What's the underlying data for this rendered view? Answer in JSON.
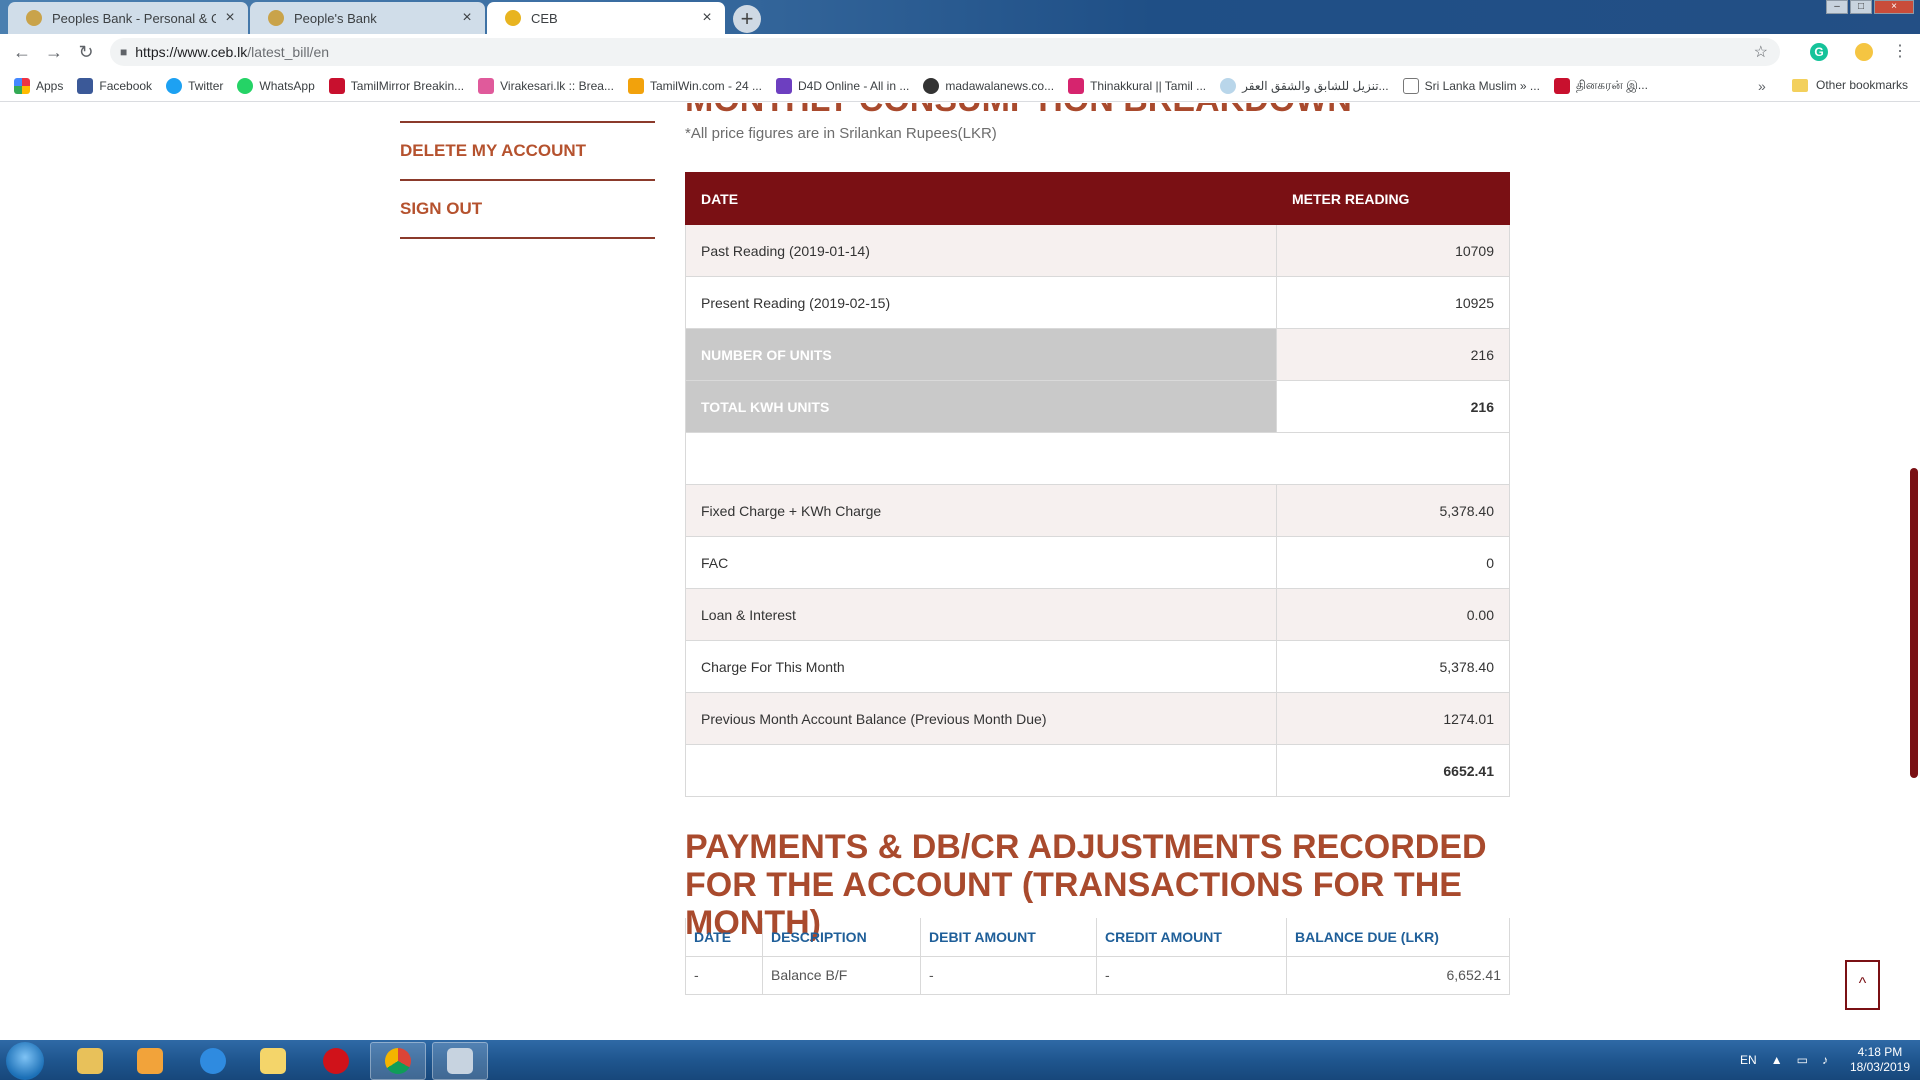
{
  "browser": {
    "tabs": [
      {
        "title": "Peoples Bank - Personal & Corpo",
        "active": false
      },
      {
        "title": "People's Bank",
        "active": false
      },
      {
        "title": "CEB",
        "active": true
      }
    ],
    "new_tab_symbol": "+",
    "url_host": "https://www.ceb.lk",
    "url_path": "/latest_bill/en",
    "bookmarks": [
      "Apps",
      "Facebook",
      "Twitter",
      "WhatsApp",
      "TamilMirror Breakin...",
      "Virakesari.lk :: Brea...",
      "TamilWin.com - 24 ...",
      "D4D Online - All in ...",
      "madawalanews.co...",
      "Thinakkural || Tamil ...",
      "تنزيل للشابق والشقق العقر...",
      "Sri Lanka Muslim » ...",
      "தினகரன் இ..."
    ],
    "bookmarks_more": "»",
    "other_bookmarks": "Other bookmarks"
  },
  "sidebar": {
    "links": [
      "DELETE MY ACCOUNT",
      "SIGN OUT"
    ]
  },
  "bill": {
    "heading_cut": "MONTHLY CONSUMPTION BREAKDOWN",
    "note": "*All price figures are in Srilankan Rupees(LKR)",
    "headers": {
      "date": "DATE",
      "reading": "METER READING"
    },
    "rows": [
      {
        "label": "Past Reading (2019-01-14)",
        "value": "10709"
      },
      {
        "label": "Present Reading (2019-02-15)",
        "value": "10925"
      },
      {
        "label": "NUMBER OF UNITS",
        "value": "216"
      },
      {
        "label": "TOTAL KWH UNITS",
        "value": "216"
      },
      {
        "label": "",
        "value": ""
      },
      {
        "label": "Fixed Charge + KWh Charge",
        "value": "5,378.40"
      },
      {
        "label": "FAC",
        "value": "0"
      },
      {
        "label": "Loan & Interest",
        "value": "0.00"
      },
      {
        "label": "Charge For This Month",
        "value": "5,378.40"
      },
      {
        "label": "Previous Month Account Balance (Previous Month Due)",
        "value": "1274.01"
      },
      {
        "label": "",
        "value": "6652.41"
      }
    ]
  },
  "transactions": {
    "heading": "PAYMENTS & DB/CR ADJUSTMENTS RECORDED FOR THE ACCOUNT (TRANSACTIONS FOR THE MONTH)",
    "headers": [
      "DATE",
      "DESCRIPTION",
      "DEBIT AMOUNT",
      "CREDIT AMOUNT",
      "BALANCE DUE (LKR)"
    ],
    "rows": [
      {
        "date": "-",
        "description": "Balance B/F",
        "debit": "-",
        "credit": "-",
        "balance": "6,652.41"
      }
    ]
  },
  "scroll_top_symbol": "^",
  "taskbar": {
    "language": "EN",
    "time": "4:18 PM",
    "date": "18/03/2019"
  }
}
